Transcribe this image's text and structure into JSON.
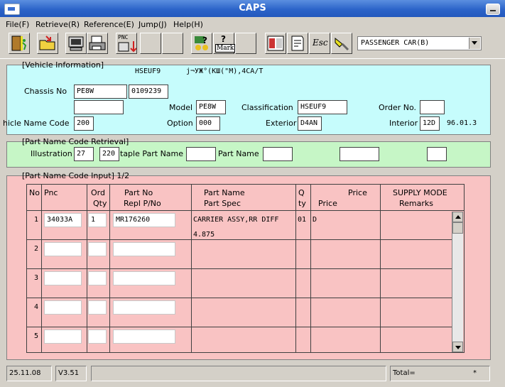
{
  "window": {
    "title": "CAPS"
  },
  "menu": {
    "items": [
      "File(F)",
      "Retrieve(R)",
      "Reference(E)",
      "Jump(J)",
      "Help(H)"
    ]
  },
  "toolbar": {
    "pnc_label": "PNC",
    "mark_label": "Mark",
    "esc_label": "Esc",
    "catalog_dropdown": "PASSENGER CAR(B)"
  },
  "vehicle": {
    "section_label": "[Vehicle Information]",
    "header_code": "HSEUF9",
    "header_desc": "j¬УЖ°(КШ(\"М),4CA/T",
    "chassis_label": "Chassis No",
    "chassis_prefix": "PE8W",
    "chassis_number": "0109239",
    "chassis_extra": "",
    "model_label": "Model",
    "model_value": "PE8W",
    "classification_label": "Classification",
    "classification_value": "HSEUF9",
    "order_label": "Order No.",
    "order_value": "",
    "vehicle_name_code_label": "hicle Name Code",
    "vehicle_name_code_value": "200",
    "option_label": "Option",
    "option_value": "000",
    "exterior_label": "Exterior",
    "exterior_value": "D4AN",
    "interior_label": "Interior",
    "interior_value": "12D",
    "date_value": "96.01.3"
  },
  "retrieval": {
    "section_label": "[Part Name Code Retrieval]",
    "illustration_label": "Illustration",
    "illustration_value1": "27",
    "illustration_value2": "220",
    "staple_label": "taple Part Name",
    "staple_value": "",
    "part_name_label": "Part Name",
    "part_name_value": "",
    "extra1": "",
    "extra2": ""
  },
  "input": {
    "section_label": "[Part Name Code Input] 1/2",
    "headers": {
      "no": "No",
      "pnc": "Pnc",
      "ord": "Ord",
      "qty": "Qty",
      "part_no": "Part No",
      "repl": "Repl P/No",
      "part_name": "Part Name",
      "part_spec": "Part Spec",
      "q": "Q",
      "ty": "ty",
      "price_top": "Price",
      "price": "Price",
      "supply": "SUPPLY MODE",
      "remarks": "Remarks"
    },
    "rows": [
      {
        "no": "1",
        "pnc": "34033A",
        "qty": "1",
        "part_no": "MR176260",
        "part_name": "CARRIER ASSY,RR DIFF",
        "part_spec": "4.875",
        "q": "01",
        "price": "D",
        "remarks": ""
      },
      {
        "no": "2",
        "pnc": "",
        "qty": "",
        "part_no": "",
        "part_name": "",
        "part_spec": "",
        "q": "",
        "price": "",
        "remarks": ""
      },
      {
        "no": "3",
        "pnc": "",
        "qty": "",
        "part_no": "",
        "part_name": "",
        "part_spec": "",
        "q": "",
        "price": "",
        "remarks": ""
      },
      {
        "no": "4",
        "pnc": "",
        "qty": "",
        "part_no": "",
        "part_name": "",
        "part_spec": "",
        "q": "",
        "price": "",
        "remarks": ""
      },
      {
        "no": "5",
        "pnc": "",
        "qty": "",
        "part_no": "",
        "part_name": "",
        "part_spec": "",
        "q": "",
        "price": "",
        "remarks": ""
      }
    ]
  },
  "status": {
    "date": "25.11.08",
    "version": "V3.51",
    "message": "",
    "total_label": "Total=",
    "total_value": "*"
  },
  "colors": {
    "vehicle_bg": "#c6fcfc",
    "retrieval_bg": "#c6f6c6",
    "input_bg": "#f9c3c3",
    "titlebar": "#2c64c9"
  }
}
